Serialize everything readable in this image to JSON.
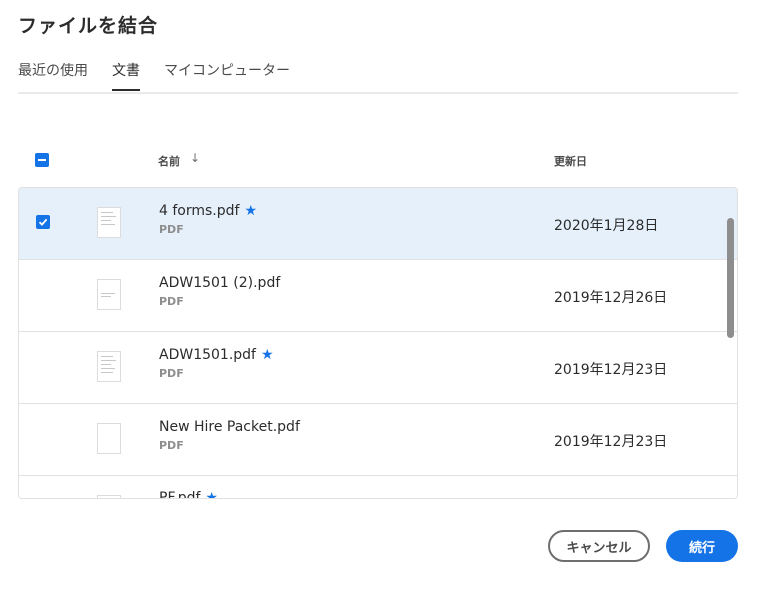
{
  "dialog": {
    "title": "ファイルを結合"
  },
  "tabs": [
    {
      "label": "最近の使用"
    },
    {
      "label": "文書"
    },
    {
      "label": "マイコンピューター"
    }
  ],
  "table": {
    "col_name": "名前",
    "col_sort_icon": "↓",
    "col_date": "更新日"
  },
  "files": [
    {
      "name": "4 forms.pdf",
      "type": "PDF",
      "date": "2020年1月28日",
      "starred": true,
      "selected": true
    },
    {
      "name": "ADW1501 (2).pdf",
      "type": "PDF",
      "date": "2019年12月26日",
      "starred": false,
      "selected": false
    },
    {
      "name": "ADW1501.pdf",
      "type": "PDF",
      "date": "2019年12月23日",
      "starred": true,
      "selected": false
    },
    {
      "name": "New Hire Packet.pdf",
      "type": "PDF",
      "date": "2019年12月23日",
      "starred": false,
      "selected": false
    },
    {
      "name": "PF.pdf",
      "type": "",
      "date": "",
      "starred": true,
      "selected": false
    }
  ],
  "star_glyph": "★",
  "buttons": {
    "cancel": "キャンセル",
    "continue": "続行"
  },
  "colors": {
    "accent": "#1473e6",
    "selected_row": "#e5f0fb"
  }
}
